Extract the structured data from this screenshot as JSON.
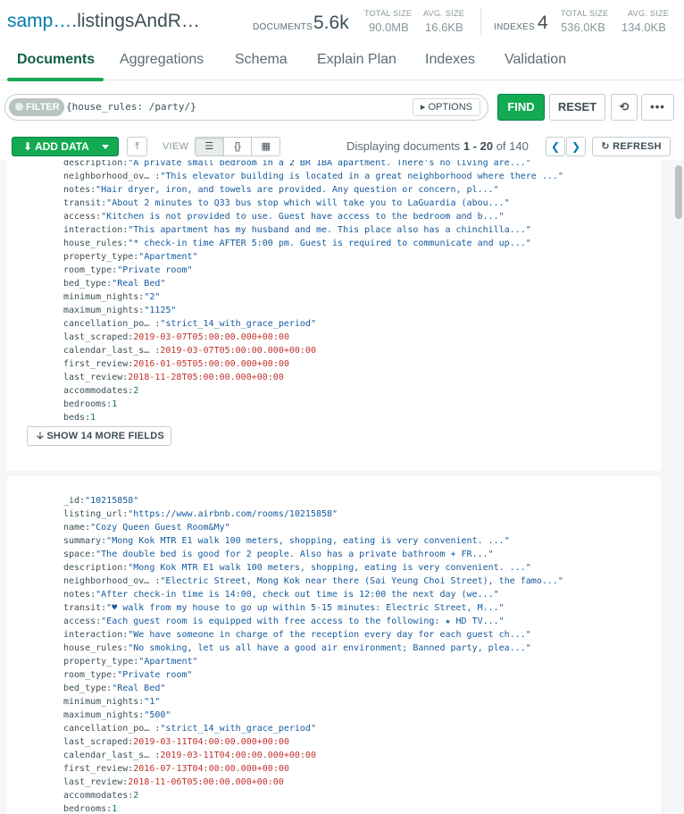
{
  "header": {
    "namespace_db": "samp…",
    "namespace_coll": ".listingsAndR…",
    "documents_label": "DOCUMENTS",
    "documents_count": "5.6k",
    "doc_total_size_label": "TOTAL SIZE",
    "doc_total_size": "90.0MB",
    "doc_avg_size_label": "AVG. SIZE",
    "doc_avg_size": "16.6KB",
    "indexes_label": "INDEXES",
    "indexes_count": "4",
    "idx_total_size_label": "TOTAL SIZE",
    "idx_total_size": "536.0KB",
    "idx_avg_size_label": "AVG. SIZE",
    "idx_avg_size": "134.0KB"
  },
  "tabs": [
    "Documents",
    "Aggregations",
    "Schema",
    "Explain Plan",
    "Indexes",
    "Validation"
  ],
  "query": {
    "filter_label": "FILTER",
    "filter_value": "{house_rules: /party/}",
    "options_label": "OPTIONS",
    "find_label": "FIND",
    "reset_label": "RESET",
    "more_label": "•••"
  },
  "controls": {
    "add_data_label": "ADD DATA",
    "view_label": "VIEW",
    "displaying_prefix": "Displaying documents",
    "range": "1 - 20",
    "of_label": "of",
    "total": "140",
    "refresh_label": "REFRESH"
  },
  "documents": [
    {
      "fields": [
        {
          "k": "description:",
          "v": "\"A private small bedroom in a 2 BR 1BA apartment. There's no living are...\"",
          "t": "str"
        },
        {
          "k": "neighborhood_ov… :",
          "v": "\"This elevator building is located in a great neighborhood where there ...\"",
          "t": "str"
        },
        {
          "k": "notes:",
          "v": "\"Hair dryer, iron, and towels are provided. Any question or concern, pl...\"",
          "t": "str"
        },
        {
          "k": "transit:",
          "v": "\"About 2 minutes to Q33 bus stop which will take you to LaGuardia (abou...\"",
          "t": "str"
        },
        {
          "k": "access:",
          "v": "\"Kitchen is not provided to use. Guest have access to the bedroom and b...\"",
          "t": "str"
        },
        {
          "k": "interaction:",
          "v": "\"This apartment has my husband and me. This place also has a chinchilla...\"",
          "t": "str"
        },
        {
          "k": "house_rules:",
          "v": "\"* check-in time AFTER 5:00 pm. Guest is required to communicate and up...\"",
          "t": "str"
        },
        {
          "k": "property_type:",
          "v": "\"Apartment\"",
          "t": "str"
        },
        {
          "k": "room_type:",
          "v": "\"Private room\"",
          "t": "str"
        },
        {
          "k": "bed_type:",
          "v": "\"Real Bed\"",
          "t": "str"
        },
        {
          "k": "minimum_nights:",
          "v": "\"2\"",
          "t": "str"
        },
        {
          "k": "maximum_nights:",
          "v": "\"1125\"",
          "t": "str"
        },
        {
          "k": "cancellation_po… :",
          "v": "\"strict_14_with_grace_period\"",
          "t": "str"
        },
        {
          "k": "last_scraped:",
          "v": "2019-03-07T05:00:00.000+00:00",
          "t": "date"
        },
        {
          "k": "calendar_last_s… :",
          "v": "2019-03-07T05:00:00.000+00:00",
          "t": "date"
        },
        {
          "k": "first_review:",
          "v": "2016-01-05T05:00:00.000+00:00",
          "t": "date"
        },
        {
          "k": "last_review:",
          "v": "2018-11-28T05:00:00.000+00:00",
          "t": "date"
        },
        {
          "k": "accommodates:",
          "v": "2",
          "t": "num"
        },
        {
          "k": "bedrooms:",
          "v": "1",
          "t": "num"
        },
        {
          "k": "beds:",
          "v": "1",
          "t": "num"
        }
      ],
      "show_more_label": "SHOW 14 MORE FIELDS"
    },
    {
      "fields": [
        {
          "k": "_id:",
          "v": "\"10215858\"",
          "t": "str"
        },
        {
          "k": "listing_url:",
          "v": "\"https://www.airbnb.com/rooms/10215858\"",
          "t": "str"
        },
        {
          "k": "name:",
          "v": "\"Cozy Queen Guest Room&My\"",
          "t": "str"
        },
        {
          "k": "summary:",
          "v": "\"Mong Kok MTR E1 walk 100 meters, shopping, eating is very convenient. ...\"",
          "t": "str"
        },
        {
          "k": "space:",
          "v": "\"The double bed is good for 2 people.  Also has a private bathroom + FR...\"",
          "t": "str"
        },
        {
          "k": "description:",
          "v": "\"Mong Kok MTR E1 walk 100 meters, shopping, eating is very convenient. ...\"",
          "t": "str"
        },
        {
          "k": "neighborhood_ov… :",
          "v": "\"Electric Street, Mong Kok near there (Sai Yeung Choi Street), the famo...\"",
          "t": "str"
        },
        {
          "k": "notes:",
          "v": "\"After check-in time is 14:00, check out time is 12:00 the next day (we...\"",
          "t": "str"
        },
        {
          "k": "transit:",
          "v": "\"♥ walk from my house to go up within 5-15 minutes:  Electric Street, M...\"",
          "t": "str"
        },
        {
          "k": "access:",
          "v": "\"Each guest room is equipped with free access to the following: ★ HD TV...\"",
          "t": "str"
        },
        {
          "k": "interaction:",
          "v": "\"We have someone in charge of the reception every day for each guest ch...\"",
          "t": "str"
        },
        {
          "k": "house_rules:",
          "v": "\"No smoking, let us all have a good air environment; Banned party, plea...\"",
          "t": "str"
        },
        {
          "k": "property_type:",
          "v": "\"Apartment\"",
          "t": "str"
        },
        {
          "k": "room_type:",
          "v": "\"Private room\"",
          "t": "str"
        },
        {
          "k": "bed_type:",
          "v": "\"Real Bed\"",
          "t": "str"
        },
        {
          "k": "minimum_nights:",
          "v": "\"1\"",
          "t": "str"
        },
        {
          "k": "maximum_nights:",
          "v": "\"500\"",
          "t": "str"
        },
        {
          "k": "cancellation_po… :",
          "v": "\"strict_14_with_grace_period\"",
          "t": "str"
        },
        {
          "k": "last_scraped:",
          "v": "2019-03-11T04:00:00.000+00:00",
          "t": "date"
        },
        {
          "k": "calendar_last_s… :",
          "v": "2019-03-11T04:00:00.000+00:00",
          "t": "date"
        },
        {
          "k": "first_review:",
          "v": "2016-07-13T04:00:00.000+00:00",
          "t": "date"
        },
        {
          "k": "last_review:",
          "v": "2018-11-06T05:00:00.000+00:00",
          "t": "date"
        },
        {
          "k": "accommodates:",
          "v": "2",
          "t": "num"
        },
        {
          "k": "bedrooms:",
          "v": "1",
          "t": "num"
        }
      ]
    }
  ],
  "colors": {
    "accent_green": "#13aa52",
    "active_tab": "#116149",
    "string_value": "#145a9c",
    "date_value": "#c0332e",
    "number_value": "#12736b"
  }
}
